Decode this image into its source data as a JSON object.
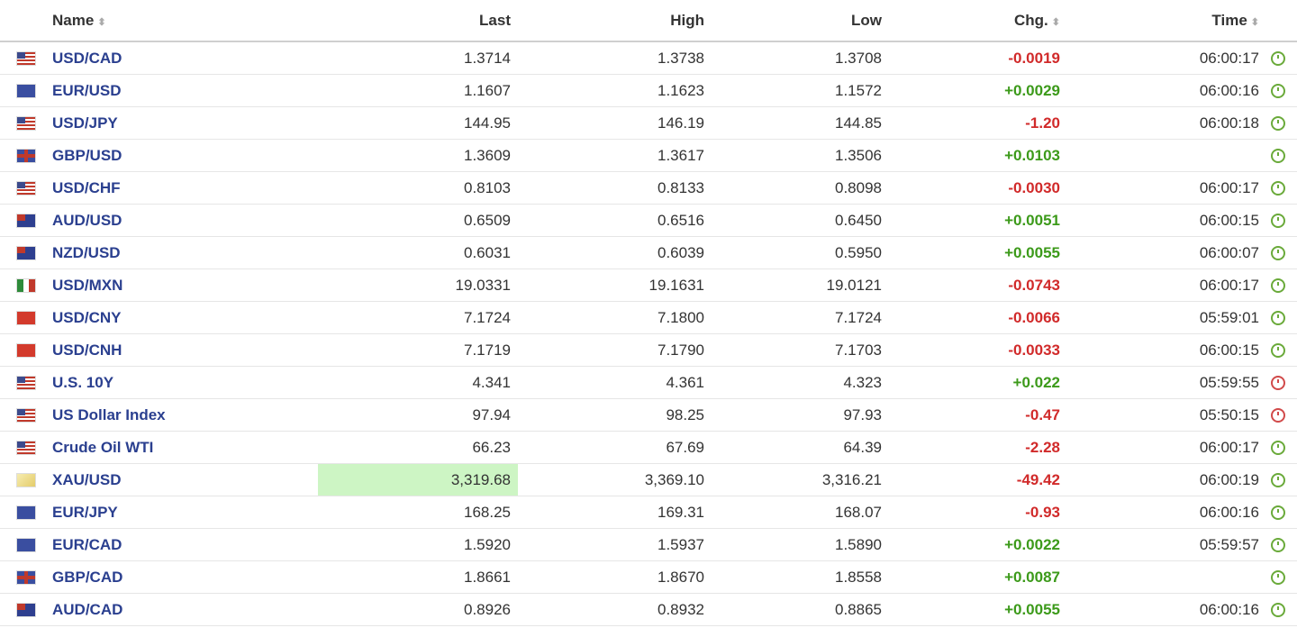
{
  "headers": {
    "name": "Name",
    "last": "Last",
    "high": "High",
    "low": "Low",
    "chg": "Chg.",
    "time": "Time",
    "sort_icon": "⬍"
  },
  "rows": [
    {
      "flag": "us",
      "name": "USD/CAD",
      "last": "1.3714",
      "high": "1.3738",
      "low": "1.3708",
      "chg": "-0.0019",
      "dir": "neg",
      "time": "06:00:17",
      "clock": "green"
    },
    {
      "flag": "eu",
      "name": "EUR/USD",
      "last": "1.1607",
      "high": "1.1623",
      "low": "1.1572",
      "chg": "+0.0029",
      "dir": "pos",
      "time": "06:00:16",
      "clock": "green"
    },
    {
      "flag": "us",
      "name": "USD/JPY",
      "last": "144.95",
      "high": "146.19",
      "low": "144.85",
      "chg": "-1.20",
      "dir": "neg",
      "time": "06:00:18",
      "clock": "green"
    },
    {
      "flag": "gb",
      "name": "GBP/USD",
      "last": "1.3609",
      "high": "1.3617",
      "low": "1.3506",
      "chg": "+0.0103",
      "dir": "pos",
      "time": "",
      "clock": "green"
    },
    {
      "flag": "us",
      "name": "USD/CHF",
      "last": "0.8103",
      "high": "0.8133",
      "low": "0.8098",
      "chg": "-0.0030",
      "dir": "neg",
      "time": "06:00:17",
      "clock": "green"
    },
    {
      "flag": "au",
      "name": "AUD/USD",
      "last": "0.6509",
      "high": "0.6516",
      "low": "0.6450",
      "chg": "+0.0051",
      "dir": "pos",
      "time": "06:00:15",
      "clock": "green"
    },
    {
      "flag": "nz",
      "name": "NZD/USD",
      "last": "0.6031",
      "high": "0.6039",
      "low": "0.5950",
      "chg": "+0.0055",
      "dir": "pos",
      "time": "06:00:07",
      "clock": "green"
    },
    {
      "flag": "mx",
      "name": "USD/MXN",
      "last": "19.0331",
      "high": "19.1631",
      "low": "19.0121",
      "chg": "-0.0743",
      "dir": "neg",
      "time": "06:00:17",
      "clock": "green"
    },
    {
      "flag": "cn",
      "name": "USD/CNY",
      "last": "7.1724",
      "high": "7.1800",
      "low": "7.1724",
      "chg": "-0.0066",
      "dir": "neg",
      "time": "05:59:01",
      "clock": "green"
    },
    {
      "flag": "cn",
      "name": "USD/CNH",
      "last": "7.1719",
      "high": "7.1790",
      "low": "7.1703",
      "chg": "-0.0033",
      "dir": "neg",
      "time": "06:00:15",
      "clock": "green"
    },
    {
      "flag": "us",
      "name": "U.S. 10Y",
      "last": "4.341",
      "high": "4.361",
      "low": "4.323",
      "chg": "+0.022",
      "dir": "pos",
      "time": "05:59:55",
      "clock": "red"
    },
    {
      "flag": "us",
      "name": "US Dollar Index",
      "last": "97.94",
      "high": "98.25",
      "low": "97.93",
      "chg": "-0.47",
      "dir": "neg",
      "time": "05:50:15",
      "clock": "red"
    },
    {
      "flag": "us",
      "name": "Crude Oil WTI",
      "last": "66.23",
      "high": "67.69",
      "low": "64.39",
      "chg": "-2.28",
      "dir": "neg",
      "time": "06:00:17",
      "clock": "green"
    },
    {
      "flag": "xau",
      "name": "XAU/USD",
      "last": "3,319.68",
      "high": "3,369.10",
      "low": "3,316.21",
      "chg": "-49.42",
      "dir": "neg",
      "time": "06:00:19",
      "clock": "green",
      "highlight": true
    },
    {
      "flag": "eu",
      "name": "EUR/JPY",
      "last": "168.25",
      "high": "169.31",
      "low": "168.07",
      "chg": "-0.93",
      "dir": "neg",
      "time": "06:00:16",
      "clock": "green"
    },
    {
      "flag": "eu",
      "name": "EUR/CAD",
      "last": "1.5920",
      "high": "1.5937",
      "low": "1.5890",
      "chg": "+0.0022",
      "dir": "pos",
      "time": "05:59:57",
      "clock": "green"
    },
    {
      "flag": "gb",
      "name": "GBP/CAD",
      "last": "1.8661",
      "high": "1.8670",
      "low": "1.8558",
      "chg": "+0.0087",
      "dir": "pos",
      "time": "",
      "clock": "green"
    },
    {
      "flag": "au",
      "name": "AUD/CAD",
      "last": "0.8926",
      "high": "0.8932",
      "low": "0.8865",
      "chg": "+0.0055",
      "dir": "pos",
      "time": "06:00:16",
      "clock": "green"
    }
  ]
}
